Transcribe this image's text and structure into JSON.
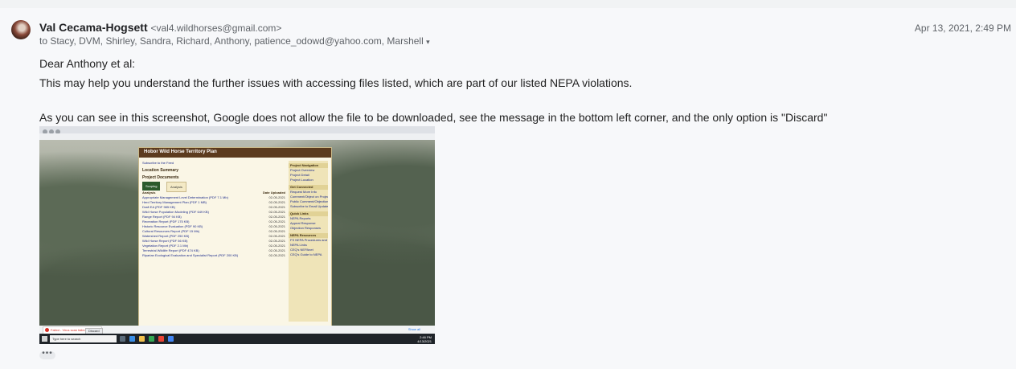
{
  "sender": {
    "name": "Val Cecama-Hogsett",
    "email": "<val4.wildhorses@gmail.com>",
    "recipients": "to Stacy, DVM, Shirley, Sandra, Richard, Anthony, patience_odowd@yahoo.com, Marshell",
    "date": "Apr 13, 2021, 2:49 PM"
  },
  "message": {
    "greeting": "Dear Anthony et al:",
    "line1": "This may help you understand the further issues with accessing files listed, which are part of our listed NEPA violations.",
    "line2": "As you can see in this screenshot, Google does not allow the file to be downloaded, see the message in the bottom left corner, and the only option is \"Discard\""
  },
  "screenshot": {
    "page_title": "Hobor Wild Horse Territory Plan",
    "subscribe": "Subscribe to the Feed",
    "location_heading": "Location Summary",
    "docs_heading": "Project Documents",
    "tabs": [
      "Scoping",
      "Analysis"
    ],
    "docs_header": "Analysis",
    "docs_date_header": "Date Uploaded",
    "doc_rows": [
      {
        "name": "Appropriate Management Level Determination (PDF 7.1 Mb)",
        "date": "02-05-2021"
      },
      {
        "name": "Herd Territory Management Plan (PDF 1 MB)",
        "date": "02-05-2021"
      },
      {
        "name": "Draft EA (PDF 985 KB)",
        "date": "02-05-2021"
      },
      {
        "name": "Wild Horse Population Modeling (PDF 649 KB)",
        "date": "02-05-2021"
      },
      {
        "name": "Range Report (PDF 94 KB)",
        "date": "02-05-2021"
      },
      {
        "name": "Recreation Report (PDF 175 KB)",
        "date": "02-05-2021"
      },
      {
        "name": "Historic Resource Evaluation (PDF 90 KB)",
        "date": "02-05-2021"
      },
      {
        "name": "Cultural Resources Report (PDF 15 Mb)",
        "date": "02-05-2021"
      },
      {
        "name": "Watershed Report (PDF 250 KB)",
        "date": "02-05-2021"
      },
      {
        "name": "Wild Horse Report (PDF 56 KB)",
        "date": "02-05-2021"
      },
      {
        "name": "Vegetation Report (PDF 2.1 Mb)",
        "date": "02-05-2021"
      },
      {
        "name": "Terrestrial Wildlife Report (PDF 474 KB)",
        "date": "02-05-2021"
      },
      {
        "name": "Riparian Ecological Evaluation and Specialist Report (PDF 200 KB)",
        "date": "02-05-2021"
      }
    ],
    "sidebar_sections": [
      {
        "heading": "Project Navigation",
        "items": [
          "Project Overview",
          "Project Detail",
          "Project Location"
        ]
      },
      {
        "heading": "Get Connected",
        "items": [
          "Request More Info",
          "Comment/Object on Project",
          "Public Comment/Objection Reading Room",
          "Subscribe to Email Updates"
        ]
      },
      {
        "heading": "Quick Links",
        "items": [
          "NEPA Reports",
          "Appeal Response",
          "Objection Responses"
        ]
      },
      {
        "heading": "NEPA Resources",
        "items": [
          "FS NEPA Procedures and Guidance",
          "NEPA Links",
          "CEQ's NEPAnet",
          "CEQ's Guide to NEPA"
        ]
      }
    ],
    "download_warning": "Failed - Virus scan failed",
    "download_button": "Discard",
    "show_all": "Show all",
    "taskbar_search": "Type here to search",
    "clock_time": "2:46 PM",
    "clock_date": "4/13/2021"
  },
  "more_button": "•••",
  "icons": {
    "avatar": "sender-avatar",
    "caret": "chevron-down-icon"
  }
}
